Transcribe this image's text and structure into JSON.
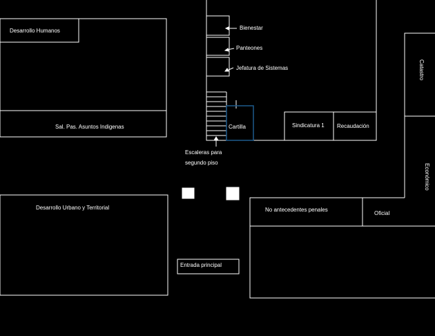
{
  "rooms": {
    "desarrollo_humanos": "Desarrollo Humanos",
    "asuntos_indigenas": "Sal. Pas. Asuntos Indigenas",
    "bienestar": "Bienestar",
    "panteones": "Panteones",
    "jefatura_sistemas": "Jefatura de Sistemas",
    "cartilla": "Cartilla",
    "sindicatura": "Sindicatura 1",
    "recaudacion": "Recaudación",
    "catastro": "Catastro",
    "economico": "Económico",
    "desarrollo_urbano": "Desarrollo Urbano y Territorial",
    "no_antecedentes": "No antecedentes penales",
    "oficial": "Oficial",
    "entrada": "Entrada principal"
  },
  "stairs_label": [
    "Escaleras para",
    "segundo piso"
  ],
  "colors": {
    "line": "#ffffff",
    "highlight": "#1e5a8c",
    "background": "#000000"
  }
}
